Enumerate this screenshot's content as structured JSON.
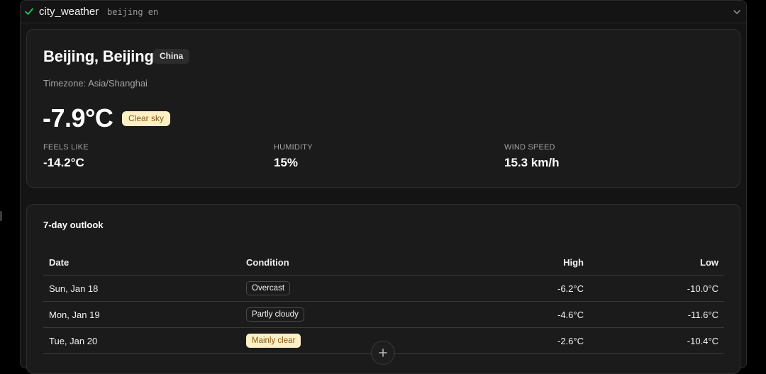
{
  "tool": {
    "name": "city_weather",
    "args": "beijing en"
  },
  "current": {
    "city": "Beijing, Beijing",
    "country": "China",
    "timezone": "Timezone: Asia/Shanghai",
    "temperature": "-7.9°C",
    "condition": "Clear sky",
    "feels_like_label": "FEELS LIKE",
    "feels_like_value": "-14.2°C",
    "humidity_label": "HUMIDITY",
    "humidity_value": "15%",
    "wind_label": "WIND SPEED",
    "wind_value": "15.3 km/h"
  },
  "outlook": {
    "title": "7-day outlook",
    "columns": [
      "Date",
      "Condition",
      "High",
      "Low"
    ],
    "rows": [
      {
        "date": "Sun, Jan 18",
        "condition": "Overcast",
        "high": "-6.2°C",
        "low": "-10.0°C",
        "style": "neutral"
      },
      {
        "date": "Mon, Jan 19",
        "condition": "Partly cloudy",
        "high": "-4.6°C",
        "low": "-11.6°C",
        "style": "neutral"
      },
      {
        "date": "Tue, Jan 20",
        "condition": "Mainly clear",
        "high": "-2.6°C",
        "low": "-10.4°C",
        "style": "warm"
      }
    ]
  },
  "colors": {
    "success": "#22c55e",
    "warm_badge_bg": "#fdf0c6",
    "warm_badge_text": "#8a5a14"
  },
  "icons": {
    "status": "check-icon",
    "collapse": "chevron-down-icon",
    "fab": "plus-icon"
  }
}
